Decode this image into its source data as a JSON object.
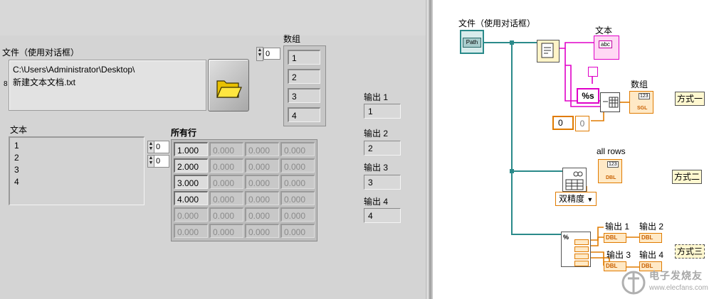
{
  "front_panel": {
    "file_label": "文件（使用对话框）",
    "path_lines": [
      "C:\\Users\\Administrator\\Desktop\\",
      "新建文本文档.txt"
    ],
    "path_type_glyph": "8",
    "array_label": "数组",
    "array_index": "0",
    "array_values": [
      "1",
      "2",
      "3",
      "4"
    ],
    "text_label": "文本",
    "text_lines": [
      "1",
      "2",
      "3",
      "4"
    ],
    "text_row_index": "0",
    "text_col_index": "0",
    "all_rows_label": "所有行",
    "table": [
      [
        "1.000",
        "0.000",
        "0.000",
        "0.000"
      ],
      [
        "2.000",
        "0.000",
        "0.000",
        "0.000"
      ],
      [
        "3.000",
        "0.000",
        "0.000",
        "0.000"
      ],
      [
        "4.000",
        "0.000",
        "0.000",
        "0.000"
      ],
      [
        "0.000",
        "0.000",
        "0.000",
        "0.000"
      ],
      [
        "0.000",
        "0.000",
        "0.000",
        "0.000"
      ]
    ],
    "outputs": [
      {
        "label": "输出 1",
        "value": "1"
      },
      {
        "label": "输出 2",
        "value": "2"
      },
      {
        "label": "输出 3",
        "value": "3"
      },
      {
        "label": "输出 4",
        "value": "4"
      }
    ]
  },
  "block_diagram": {
    "file_label": "文件（使用对话框）",
    "path_glyph": "Path",
    "text_label": "文本",
    "string_glyph": "abc",
    "array_label": "数组",
    "array_glyph": "123",
    "sgl_glyph": "SGL",
    "dbl_glyph": "DBL",
    "format_const": "%s",
    "const_zero_a": "0",
    "const_zero_b": "0",
    "all_rows_label": "all rows",
    "double_selector": "双精度",
    "output_labels": [
      "输出 1",
      "输出 2",
      "输出 3",
      "输出 4"
    ],
    "methods": [
      "方式一",
      "方式二",
      "方式三"
    ],
    "watermark_main": "电子发烧友",
    "watermark_url": "www.elecfans.com"
  },
  "colors": {
    "front_panel_bg": "#d4d4d4",
    "wire_path": "#2a8a8a",
    "wire_string": "#e000c8",
    "wire_numeric": "#e07b00",
    "block_bg": "#ffffff"
  }
}
